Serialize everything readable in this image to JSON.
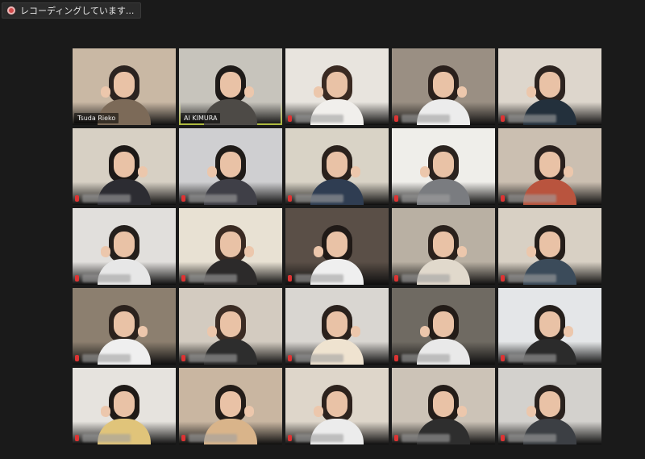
{
  "recording": {
    "label": "レコーディングしています..."
  },
  "participants": [
    {
      "name": "Tsuda Rieko",
      "bg": "#c9b8a4",
      "hair": "#2b2320",
      "shirt": "#7c6a58"
    },
    {
      "name": "AI KIMURA",
      "bg": "#c7c4bc",
      "hair": "#1e1a18",
      "shirt": "#4d4a46",
      "active": true
    },
    {
      "name": "",
      "bg": "#e8e4de",
      "hair": "#3a2a22",
      "shirt": "#f1efec"
    },
    {
      "name": "",
      "bg": "#9a8f83",
      "hair": "#2a201c",
      "shirt": "#ececec"
    },
    {
      "name": "",
      "bg": "#ddd6cc",
      "hair": "#2d2420",
      "shirt": "#23303c"
    },
    {
      "name": "",
      "bg": "#d7d0c4",
      "hair": "#1d1917",
      "shirt": "#2c2c32"
    },
    {
      "name": "",
      "bg": "#cfcfd1",
      "hair": "#1f1b18",
      "shirt": "#3f3f47"
    },
    {
      "name": "",
      "bg": "#d9d3c6",
      "hair": "#2a211c",
      "shirt": "#2f3d52"
    },
    {
      "name": "",
      "bg": "#efeeea",
      "hair": "#2b231f",
      "shirt": "#7a7c80"
    },
    {
      "name": "",
      "bg": "#cbbfb1",
      "hair": "#2b211e",
      "shirt": "#b9543e"
    },
    {
      "name": "",
      "bg": "#e1dfdc",
      "hair": "#241f1c",
      "shirt": "#e7e7e7"
    },
    {
      "name": "",
      "bg": "#e8e1d3",
      "hair": "#3a2a22",
      "shirt": "#2c2a2a"
    },
    {
      "name": "",
      "bg": "#5a4f47",
      "hair": "#201a17",
      "shirt": "#efefef"
    },
    {
      "name": "",
      "bg": "#b9b0a3",
      "hair": "#2a211c",
      "shirt": "#e1d9cc"
    },
    {
      "name": "",
      "bg": "#d8d0c4",
      "hair": "#251e1a",
      "shirt": "#3b4b5a"
    },
    {
      "name": "",
      "bg": "#8c7f6f",
      "hair": "#2b221d",
      "shirt": "#efefef"
    },
    {
      "name": "",
      "bg": "#d3cbc0",
      "hair": "#3b2c24",
      "shirt": "#2d2d2d"
    },
    {
      "name": "",
      "bg": "#d9d6d1",
      "hair": "#2a211c",
      "shirt": "#efe3d0"
    },
    {
      "name": "",
      "bg": "#6f6a62",
      "hair": "#231c18",
      "shirt": "#e9e9e9"
    },
    {
      "name": "",
      "bg": "#e4e6e8",
      "hair": "#251f1b",
      "shirt": "#2b2b2b"
    },
    {
      "name": "",
      "bg": "#e6e3de",
      "hair": "#1f1a17",
      "shirt": "#e0c47a"
    },
    {
      "name": "",
      "bg": "#c9b6a1",
      "hair": "#231c18",
      "shirt": "#d9b48a"
    },
    {
      "name": "",
      "bg": "#ded6ca",
      "hair": "#2d221d",
      "shirt": "#ececec"
    },
    {
      "name": "",
      "bg": "#ccc3b7",
      "hair": "#241d19",
      "shirt": "#2e2e2e"
    },
    {
      "name": "",
      "bg": "#d3d1cd",
      "hair": "#2a221e",
      "shirt": "#3c3f44"
    }
  ]
}
